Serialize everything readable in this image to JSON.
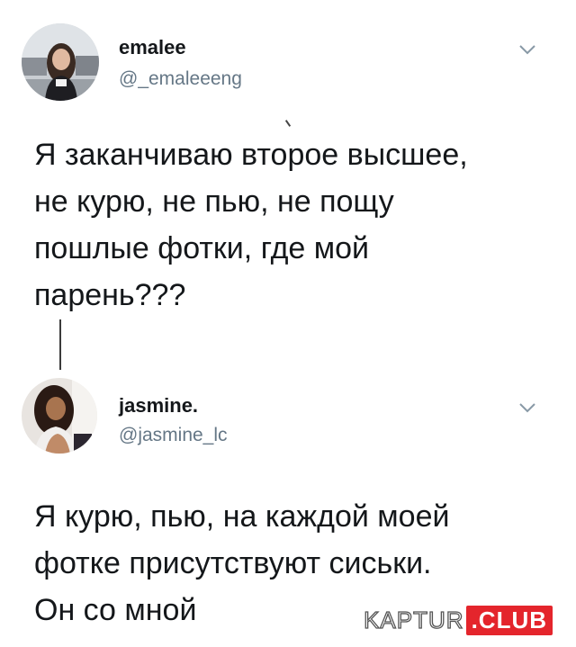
{
  "tweet1": {
    "display_name": "emalee",
    "handle": "@_emaleeeng",
    "lines": [
      "Я заканчиваю второе высшее,",
      "не курю, не пью, не пощу",
      "пошлые фотки, где мой",
      "парень???"
    ],
    "avatar_icon": "profile-photo",
    "menu_icon": "chevron-down-icon"
  },
  "tweet2": {
    "display_name": "jasmine.",
    "handle": "@jasmine_lc",
    "lines": [
      "Я курю, пью, на каждой моей",
      "фотке присутствуют сиськи.",
      "Он со мной"
    ],
    "avatar_icon": "profile-photo",
    "menu_icon": "chevron-down-icon"
  },
  "watermark": {
    "brand": "KAPTUR",
    "suffix": ".CLUB",
    "accent": "#e4252c"
  },
  "colors": {
    "text": "#14171a",
    "secondary": "#657786",
    "background": "#ffffff"
  }
}
